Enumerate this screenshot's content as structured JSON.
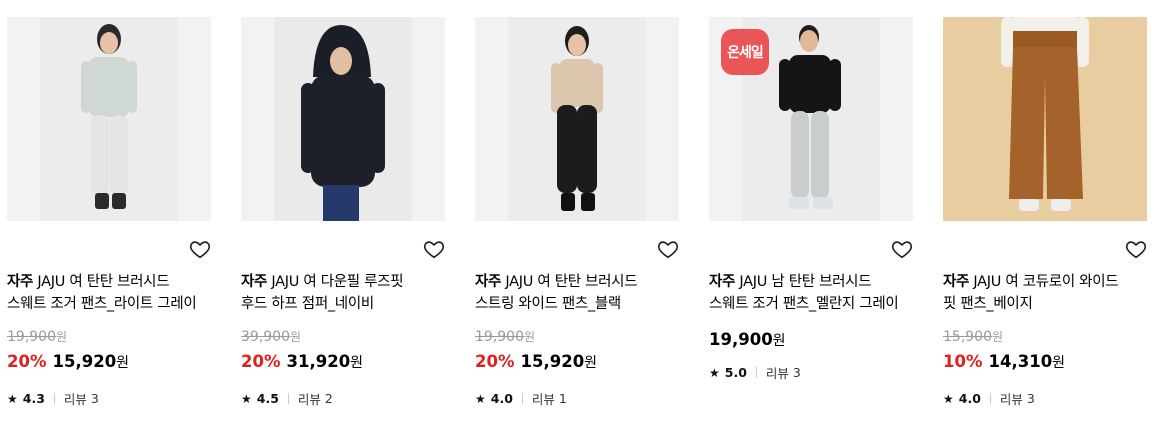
{
  "products": [
    {
      "brand": "자주",
      "name_line1": "JAJU 여 탄탄 브러시드",
      "name_line2": "스웨트 조거 팬츠_라이트 그레이",
      "original_price": "19,900",
      "discount": "20%",
      "price": "15,920",
      "currency": "원",
      "rating": "4.3",
      "review_label": "리뷰",
      "review_count": "3",
      "badge": null
    },
    {
      "brand": "자주",
      "name_line1": "JAJU 여 다운필 루즈핏",
      "name_line2": "후드 하프 점퍼_네이비",
      "original_price": "39,900",
      "discount": "20%",
      "price": "31,920",
      "currency": "원",
      "rating": "4.5",
      "review_label": "리뷰",
      "review_count": "2",
      "badge": null
    },
    {
      "brand": "자주",
      "name_line1": "JAJU 여 탄탄 브러시드",
      "name_line2": "스트링 와이드 팬츠_블랙",
      "original_price": "19,900",
      "discount": "20%",
      "price": "15,920",
      "currency": "원",
      "rating": "4.0",
      "review_label": "리뷰",
      "review_count": "1",
      "badge": null
    },
    {
      "brand": "자주",
      "name_line1": "JAJU 남 탄탄 브러시드",
      "name_line2": "스웨트 조거 팬츠_멜란지 그레이",
      "original_price": null,
      "discount": null,
      "price": "19,900",
      "currency": "원",
      "rating": "5.0",
      "review_label": "리뷰",
      "review_count": "3",
      "badge": "온세일"
    },
    {
      "brand": "자주",
      "name_line1": "JAJU 여 코듀로이 와이드",
      "name_line2": "핏 팬츠_베이지",
      "original_price": "15,900",
      "discount": "10%",
      "price": "14,310",
      "currency": "원",
      "rating": "4.0",
      "review_label": "리뷰",
      "review_count": "3",
      "badge": null
    }
  ],
  "colors": {
    "discount": "#e02020",
    "badge_bg": "#ea5656",
    "strike": "#999999"
  },
  "icons": {
    "wishlist": "heart-outline-icon",
    "rating": "star-icon"
  }
}
